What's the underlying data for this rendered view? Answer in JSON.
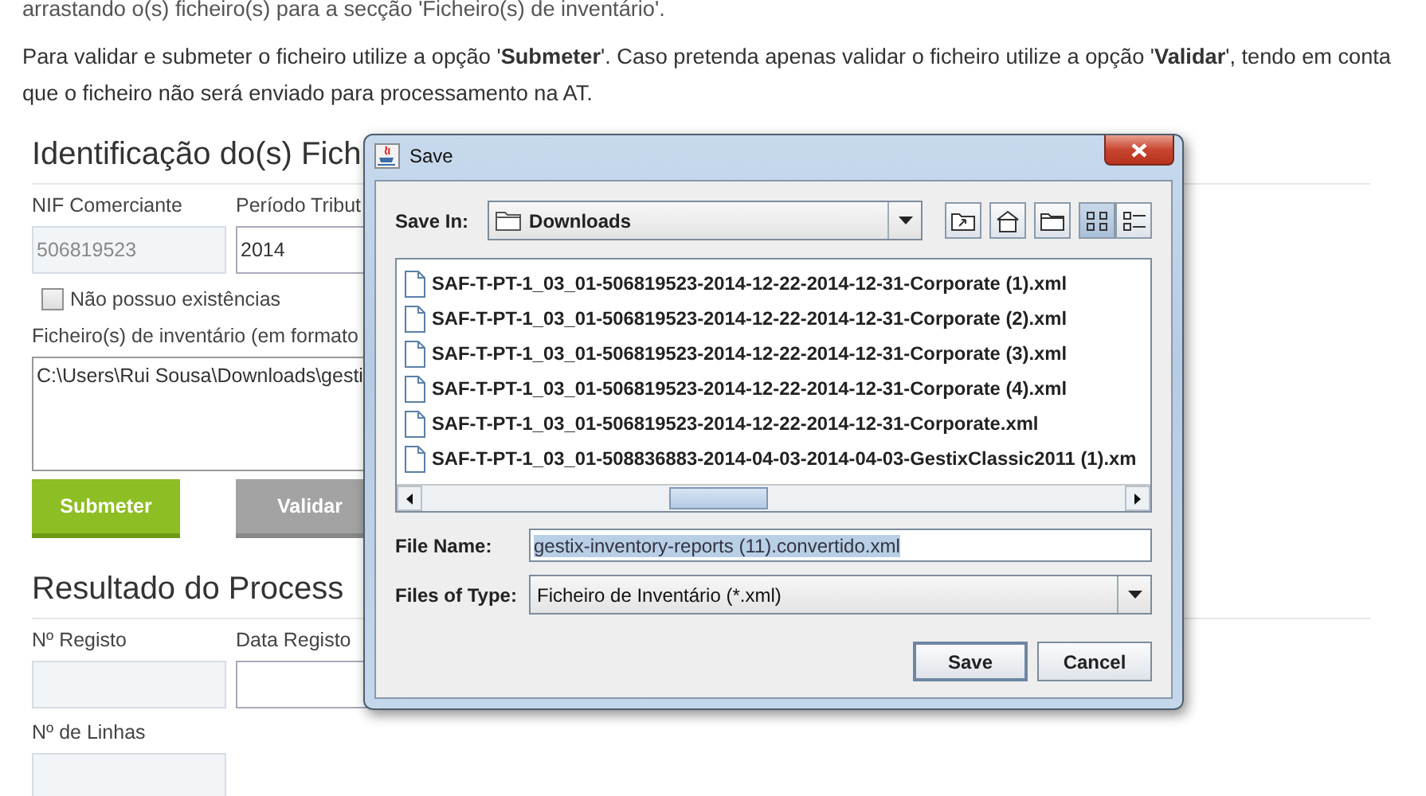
{
  "paragraphs": [
    "arrastando o(s) ficheiro(s) para a secção 'Ficheiro(s) de inventário'.",
    "Para validar e submeter o ficheiro utilize a opção '**Submeter**'. Caso pretenda apenas validar o ficheiro utilize a opção '**Validar**', tendo em conta que o ficheiro não será enviado para processamento na AT."
  ],
  "identification": {
    "title": "Identificação do(s) Fich",
    "fields": [
      {
        "label": "NIF Comerciante",
        "value": "506819523",
        "disabled": true
      },
      {
        "label": "Período Tribut",
        "value": "2014",
        "disabled": false
      }
    ],
    "checkbox": {
      "label": "Não possuo existências",
      "checked": false
    },
    "files_label": "Ficheiro(s) de inventário (em formato",
    "files_value": "C:\\Users\\Rui Sousa\\Downloads\\gesti",
    "buttons": [
      {
        "label": "Submeter",
        "kind": "primary"
      },
      {
        "label": "Validar",
        "kind": "secondary"
      }
    ]
  },
  "result": {
    "title": "Resultado do Process",
    "fields": [
      {
        "label": "Nº Registo"
      },
      {
        "label": "Data Registo"
      },
      {
        "label": "Nº de Linhas"
      }
    ]
  },
  "dialog": {
    "title": "Save",
    "save_in_label": "Save In:",
    "location": "Downloads",
    "view_modes": [
      {
        "kind": "list",
        "selected": true
      },
      {
        "kind": "details",
        "selected": false
      }
    ],
    "files": [
      "SAF-T-PT-1_03_01-506819523-2014-12-22-2014-12-31-Corporate (1).xml",
      "SAF-T-PT-1_03_01-506819523-2014-12-22-2014-12-31-Corporate (2).xml",
      "SAF-T-PT-1_03_01-506819523-2014-12-22-2014-12-31-Corporate (3).xml",
      "SAF-T-PT-1_03_01-506819523-2014-12-22-2014-12-31-Corporate (4).xml",
      "SAF-T-PT-1_03_01-506819523-2014-12-22-2014-12-31-Corporate.xml",
      "SAF-T-PT-1_03_01-508836883-2014-04-03-2014-04-03-GestixClassic2011 (1).xm"
    ],
    "file_name_label": "File Name:",
    "file_name": "gestix-inventory-reports (11).convertido.xml",
    "file_name_selected": true,
    "type_label": "Files of Type:",
    "file_type": "Ficheiro de Inventário (*.xml)",
    "buttons": [
      {
        "label": "Save",
        "kind": "default"
      },
      {
        "label": "Cancel",
        "kind": "normal"
      }
    ]
  }
}
